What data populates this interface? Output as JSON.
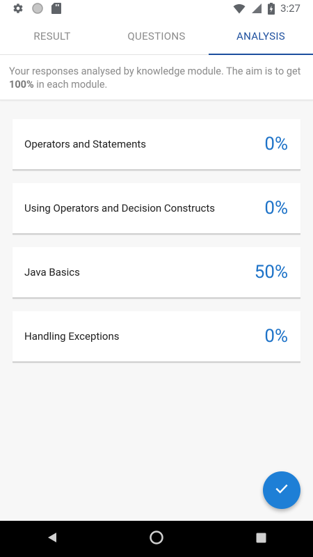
{
  "status_bar": {
    "time": "3:27",
    "left_icons": [
      "gear-icon",
      "circle-icon",
      "sd-card-icon"
    ],
    "right_icons": [
      "wifi-icon",
      "signal-icon",
      "battery-icon"
    ]
  },
  "tabs": [
    {
      "label": "RESULT",
      "active": false
    },
    {
      "label": "QUESTIONS",
      "active": false
    },
    {
      "label": "ANALYSIS",
      "active": true
    }
  ],
  "info": {
    "text_before": "Your responses analysed by knowledge module. The aim is to get ",
    "highlight": "100%",
    "text_after": " in each module."
  },
  "modules": [
    {
      "name": "Operators and Statements",
      "score": "0%"
    },
    {
      "name": "Using Operators and Decision Constructs",
      "score": "0%"
    },
    {
      "name": "Java Basics",
      "score": "50%"
    },
    {
      "name": "Handling Exceptions",
      "score": "0%"
    }
  ],
  "fab": {
    "icon": "check-icon"
  },
  "nav_bar": {
    "buttons": [
      "back-icon",
      "home-icon",
      "recents-icon"
    ]
  },
  "colors": {
    "accent": "#1d4f9e",
    "score": "#1e73c8",
    "fab": "#1e7fd6"
  }
}
